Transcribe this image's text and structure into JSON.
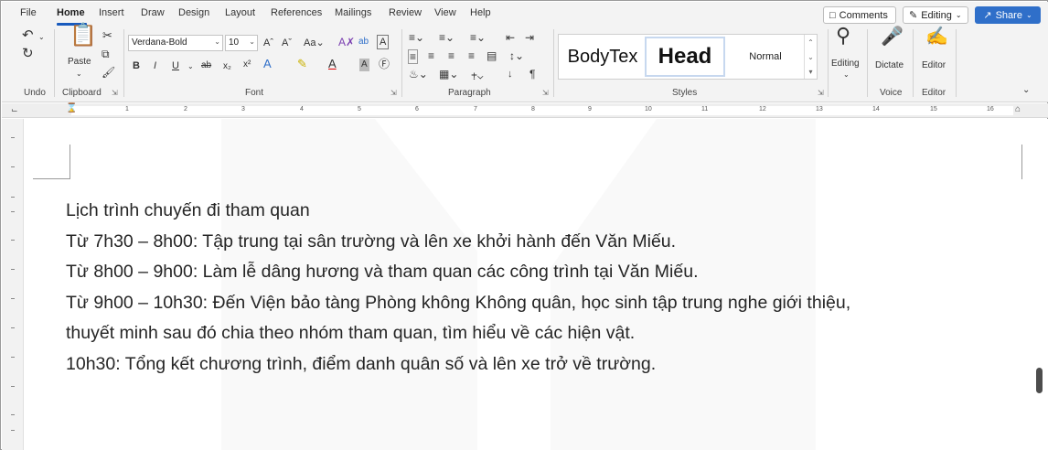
{
  "menu": {
    "tabs": [
      "File",
      "Home",
      "Insert",
      "Draw",
      "Design",
      "Layout",
      "References",
      "Mailings",
      "Review",
      "View",
      "Help"
    ],
    "active_tab": "Home",
    "comments_label": "Comments",
    "editing_label": "Editing",
    "share_label": "Share"
  },
  "ribbon": {
    "groups": {
      "undo": "Undo",
      "clipboard": "Clipboard",
      "font": "Font",
      "paragraph": "Paragraph",
      "styles": "Styles",
      "voice": "Voice",
      "editor": "Editor"
    },
    "paste_label": "Paste",
    "font_name": "Verdana-Bold",
    "font_size": "10",
    "styles_gallery": [
      "BodyTex",
      "Head",
      "Normal"
    ],
    "editing_button": "Editing",
    "dictate_button": "Dictate",
    "editor_button": "Editor"
  },
  "ruler": {
    "numbers": [
      "1",
      "2",
      "3",
      "4",
      "5",
      "6",
      "7",
      "8",
      "9",
      "10",
      "11",
      "12",
      "13",
      "14",
      "15",
      "16"
    ]
  },
  "document": {
    "lines": [
      "Lịch trình chuyến đi tham quan",
      "Từ 7h30 – 8h00: Tập trung tại sân trường và lên xe khởi hành đến Văn Miếu.",
      "Từ 8h00 – 9h00: Làm lễ dâng hương và tham quan các công trình tại Văn Miếu.",
      "Từ 9h00 – 10h30: Đến Viện bảo tàng Phòng không Không quân, học sinh tập trung nghe giới thiệu,",
      "thuyết minh sau đó chia theo nhóm tham quan, tìm hiểu về các hiện vật.",
      "10h30: Tổng kết chương trình, điểm danh quân số và lên xe trở về trường."
    ]
  },
  "colors": {
    "accent": "#185abd",
    "share": "#2f6fc9",
    "ribbon_bg": "#f3f3f3"
  }
}
